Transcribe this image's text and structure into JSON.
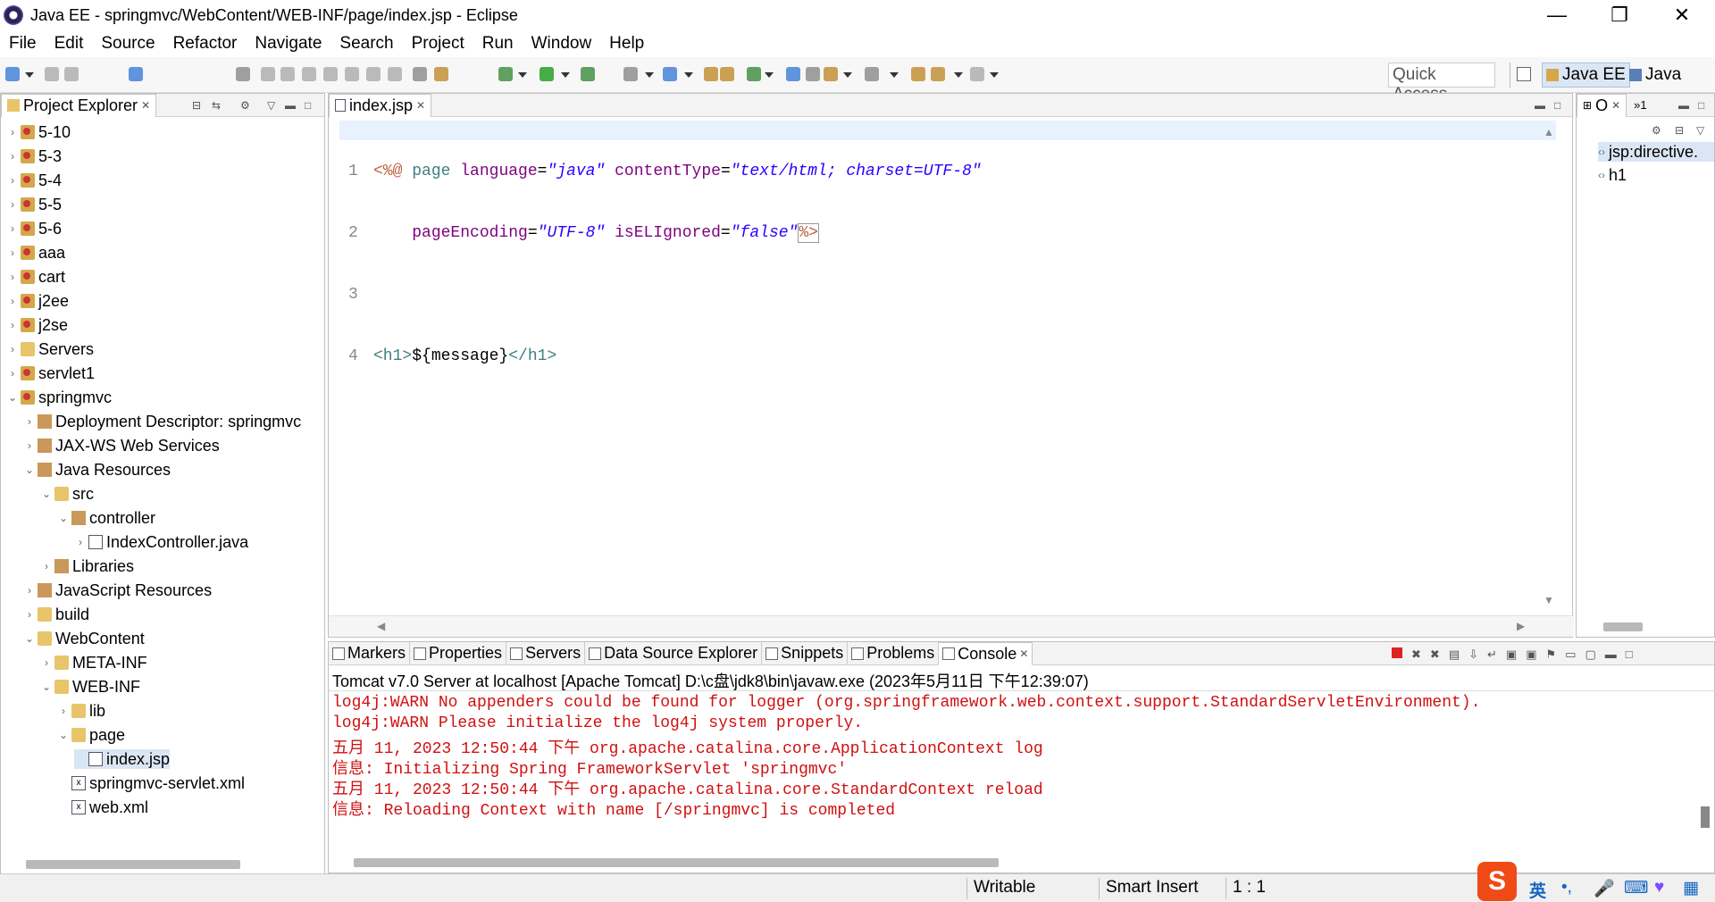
{
  "window": {
    "title": "Java EE - springmvc/WebContent/WEB-INF/page/index.jsp - Eclipse",
    "controls": [
      "—",
      "❐",
      "✕"
    ]
  },
  "menu": [
    "File",
    "Edit",
    "Source",
    "Refactor",
    "Navigate",
    "Search",
    "Project",
    "Run",
    "Window",
    "Help"
  ],
  "toolbar": {
    "quick_access": "Quick Access",
    "perspectives": [
      "Java EE",
      "Java"
    ]
  },
  "project_explorer": {
    "title": "Project Explorer",
    "items": [
      {
        "label": "5-10"
      },
      {
        "label": "5-3"
      },
      {
        "label": "5-4"
      },
      {
        "label": "5-5"
      },
      {
        "label": "5-6"
      },
      {
        "label": "aaa"
      },
      {
        "label": "cart"
      },
      {
        "label": "j2ee"
      },
      {
        "label": "j2se"
      },
      {
        "label": "Servers"
      },
      {
        "label": "servlet1"
      },
      {
        "label": "springmvc"
      },
      {
        "label": "Deployment Descriptor: springmvc"
      },
      {
        "label": "JAX-WS Web Services"
      },
      {
        "label": "Java Resources"
      },
      {
        "label": "src"
      },
      {
        "label": "controller"
      },
      {
        "label": "IndexController.java"
      },
      {
        "label": "Libraries"
      },
      {
        "label": "JavaScript Resources"
      },
      {
        "label": "build"
      },
      {
        "label": "WebContent"
      },
      {
        "label": "META-INF"
      },
      {
        "label": "WEB-INF"
      },
      {
        "label": "lib"
      },
      {
        "label": "page"
      },
      {
        "label": "index.jsp"
      },
      {
        "label": "springmvc-servlet.xml"
      },
      {
        "label": "web.xml"
      }
    ]
  },
  "editor": {
    "tab": "index.jsp",
    "line_numbers": [
      "1",
      "2",
      "3",
      "4"
    ],
    "line1": {
      "open": "<%@",
      "kw": "page",
      "a1": "language",
      "v1": "\"java\"",
      "a2": "contentType",
      "v2": "\"text/html; charset=UTF-8\""
    },
    "line2": {
      "a1": "pageEncoding",
      "v1": "\"UTF-8\"",
      "a2": "isELIgnored",
      "v2": "\"false\"",
      "close": "%>"
    },
    "line4": {
      "open": "<h1>",
      "text": "${message}",
      "close": "</h1>"
    }
  },
  "outline": {
    "tab": "O",
    "extra": "»1",
    "items": [
      "jsp:directive.",
      "h1"
    ]
  },
  "bottom_tabs": [
    "Markers",
    "Properties",
    "Servers",
    "Data Source Explorer",
    "Snippets",
    "Problems",
    "Console"
  ],
  "console": {
    "header": "Tomcat v7.0 Server at localhost [Apache Tomcat] D:\\c盘\\jdk8\\bin\\javaw.exe (2023年5月11日 下午12:39:07)",
    "lines": [
      "log4j:WARN No appenders could be found for logger (org.springframework.web.context.support.StandardServletEnvironment).",
      "log4j:WARN Please initialize the log4j system properly.",
      "五月 11, 2023 12:50:44 下午 org.apache.catalina.core.ApplicationContext log",
      "信息: Initializing Spring FrameworkServlet 'springmvc'",
      "五月 11, 2023 12:50:44 下午 org.apache.catalina.core.StandardContext reload",
      "信息: Reloading Context with name [/springmvc] is completed"
    ]
  },
  "status": {
    "writable": "Writable",
    "insert_mode": "Smart Insert",
    "position": "1 : 1"
  },
  "ime": {
    "lang": "英"
  }
}
